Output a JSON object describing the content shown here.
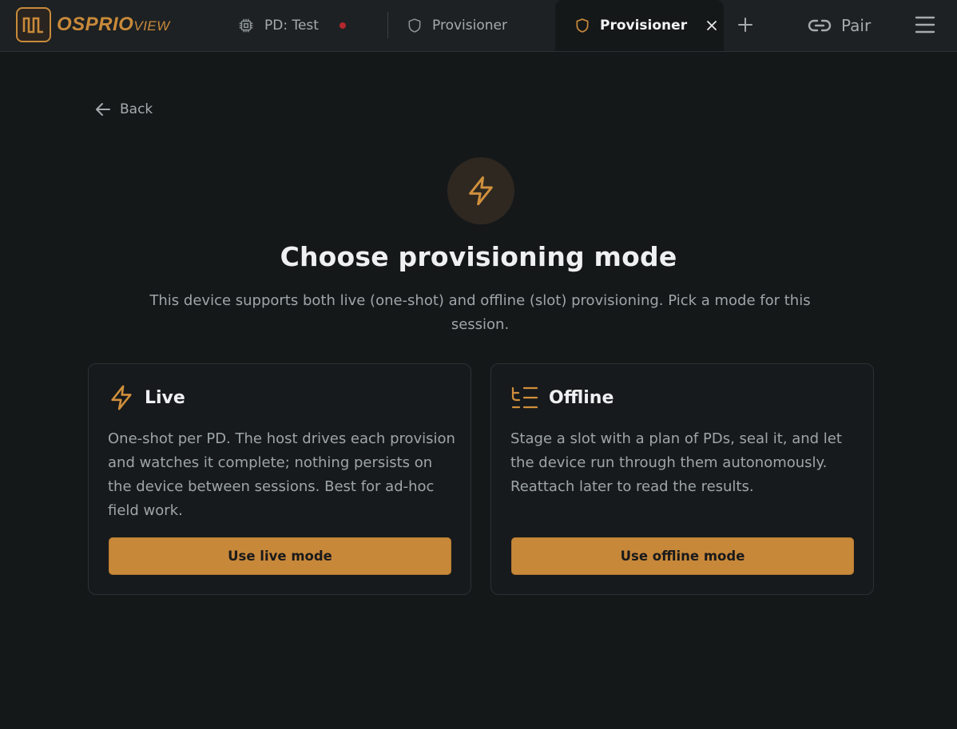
{
  "app": {
    "logo_text_bold": "OSPRIO",
    "logo_text_light": "VIEW",
    "accent_color": "#c98a3a"
  },
  "tabs": [
    {
      "label": "PD: Test",
      "icon": "chip-icon",
      "status": "unsaved-dot",
      "status_color": "#b3272d"
    },
    {
      "label": "Provisioner",
      "icon": "shield-icon"
    },
    {
      "label": "Provisioner",
      "icon": "shield-icon",
      "active": true,
      "closable": true
    }
  ],
  "header": {
    "new_tab_icon": "plus-icon",
    "pair_label": "Pair",
    "pair_icon": "link-icon",
    "menu_icon": "hamburger-icon"
  },
  "main": {
    "back_label": "Back",
    "hero_icon": "lightning-icon",
    "title": "Choose provisioning mode",
    "subtitle": "This device supports both live (one-shot) and offline (slot) provisioning. Pick a mode for this session."
  },
  "modes": [
    {
      "title": "Live",
      "icon": "lightning-icon",
      "description": "One-shot per PD. The host drives each provision and watches it complete; nothing persists on the device between sessions. Best for ad-hoc field work.",
      "button_label": "Use live mode"
    },
    {
      "title": "Offline",
      "icon": "list-icon",
      "description": "Stage a slot with a plan of PDs, seal it, and let the device run through them autonomously. Reattach later to read the results.",
      "button_label": "Use offline mode"
    }
  ]
}
